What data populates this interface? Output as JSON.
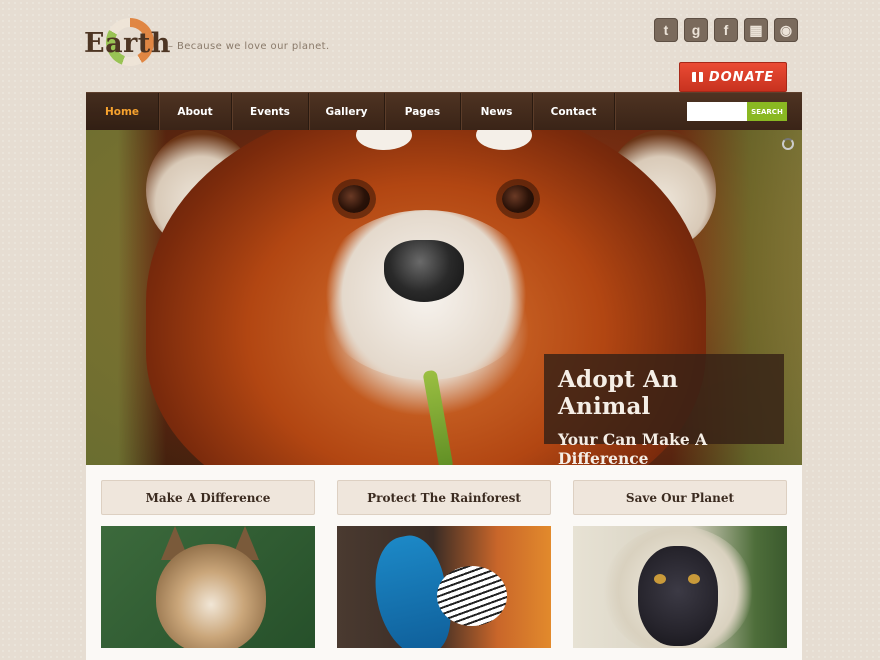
{
  "header": {
    "logo_text": "Earth",
    "tagline": "– Because we love our planet.",
    "social": [
      {
        "icon": "twitter-icon",
        "glyph": "t"
      },
      {
        "icon": "googleplus-icon",
        "glyph": "g"
      },
      {
        "icon": "facebook-icon",
        "glyph": "f"
      },
      {
        "icon": "calendar-icon",
        "glyph": "▦"
      },
      {
        "icon": "rss-icon",
        "glyph": "◉"
      }
    ],
    "donate_label": "DONATE"
  },
  "nav": {
    "items": [
      {
        "label": "Home",
        "active": true
      },
      {
        "label": "About",
        "active": false
      },
      {
        "label": "Events",
        "active": false
      },
      {
        "label": "Gallery",
        "active": false
      },
      {
        "label": "Pages",
        "active": false
      },
      {
        "label": "News",
        "active": false
      },
      {
        "label": "Contact",
        "active": false
      }
    ],
    "search_placeholder": "",
    "search_button": "SEARCH"
  },
  "hero": {
    "caption_title": "Adopt An Animal",
    "caption_subtitle": "Your Can Make A Difference"
  },
  "features": [
    {
      "title": "Make A Difference",
      "image": "lynx"
    },
    {
      "title": "Protect The Rainforest",
      "image": "parrot"
    },
    {
      "title": "Save Our Planet",
      "image": "monkey"
    }
  ],
  "colors": {
    "accent_orange": "#f7a22e",
    "donate_red": "#d83d27",
    "nav_brown": "#3a2417",
    "search_green": "#8ab822"
  }
}
